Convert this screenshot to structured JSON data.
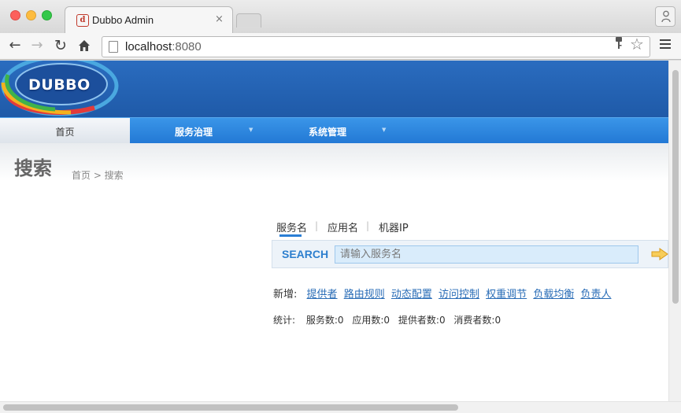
{
  "browser": {
    "tab_title": "Dubbo Admin",
    "tab_close": "×",
    "url_host": "localhost",
    "url_port": ":8080"
  },
  "header": {
    "logo_text": "DUBBO"
  },
  "nav": {
    "home": "首页",
    "items": [
      {
        "label": "服务治理"
      },
      {
        "label": "系统管理"
      }
    ]
  },
  "page": {
    "title": "搜索",
    "breadcrumb": "首页 > 搜索"
  },
  "search": {
    "tabs": [
      "服务名",
      "应用名",
      "机器IP"
    ],
    "label": "SEARCH",
    "placeholder": "请输入服务名"
  },
  "create": {
    "label": "新增:",
    "links": [
      "提供者",
      "路由规则",
      "动态配置",
      "访问控制",
      "权重调节",
      "负载均衡",
      "负责人"
    ]
  },
  "stats": {
    "label": "统计:",
    "items": [
      "服务数:0",
      "应用数:0",
      "提供者数:0",
      "消费者数:0"
    ]
  },
  "colors": {
    "header_blue": "#2a6cbf",
    "nav_blue": "#2379d5",
    "search_accent": "#2d7fce",
    "link": "#2a6db7",
    "arrow": "#f0b73a"
  }
}
